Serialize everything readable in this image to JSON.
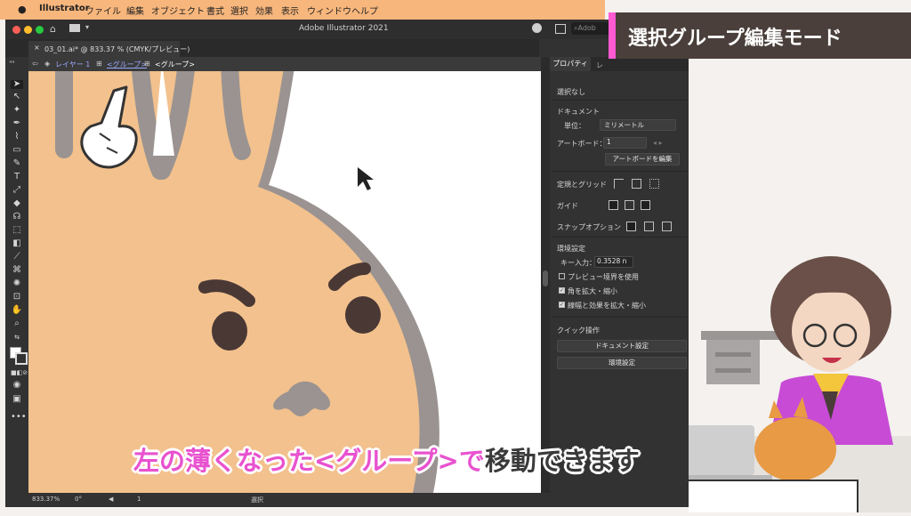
{
  "menubar": {
    "apple": "",
    "items": [
      "Illustrator",
      "ファイル",
      "編集",
      "オブジェクト",
      "書式",
      "選択",
      "効果",
      "表示",
      "ウィンドウ",
      "ヘルプ"
    ]
  },
  "window": {
    "title": "Adobe Illustrator 2021",
    "search_placeholder": "Adob"
  },
  "document_tab": {
    "label": "03_01.ai* @ 833.37 % (CMYK/プレビュー)",
    "close": "×"
  },
  "isolation_bar": {
    "layer": "レイヤー 1",
    "group1": "<グループ>",
    "group2": "<グループ>"
  },
  "status_bar": {
    "zoom": "833.37%",
    "rotation": "0°",
    "artboard": "1",
    "mode": "選択"
  },
  "panel": {
    "tab_active": "プロパティ",
    "tab_other": "レ",
    "selection": "選択なし",
    "document_heading": "ドキュメント",
    "unit_label": "単位：",
    "unit_value": "ミリメートル",
    "artboard_label": "アートボード：",
    "artboard_value": "1",
    "edit_artboard_button": "アートボードを編集",
    "rulers_grid": "定規とグリッド",
    "guides": "ガイド",
    "snap_options": "スナップオプション",
    "preferences_heading": "環境設定",
    "key_input_label": "キー入力：",
    "key_input_value": "0.3528 n",
    "use_preview_bounds": "プレビュー境界を使用",
    "scale_corners": "角を拡大・縮小",
    "scale_strokes": "線幅と効果を拡大・縮小",
    "quick_actions": "クイック操作",
    "document_settings_button": "ドキュメント設定",
    "preferences_button": "環境設定"
  },
  "caption": {
    "title": "選択グループ編集モード",
    "subtitle_highlight": "左の薄くなった<グループ>で",
    "subtitle_rest": "移動できます"
  },
  "colors": {
    "menubar": "#f7b67c",
    "bunny_fill": "#f2c18d",
    "bunny_outline": "#9a9391",
    "accent_pink": "#ff5ad2",
    "caption_bg": "#4a3f3a"
  }
}
